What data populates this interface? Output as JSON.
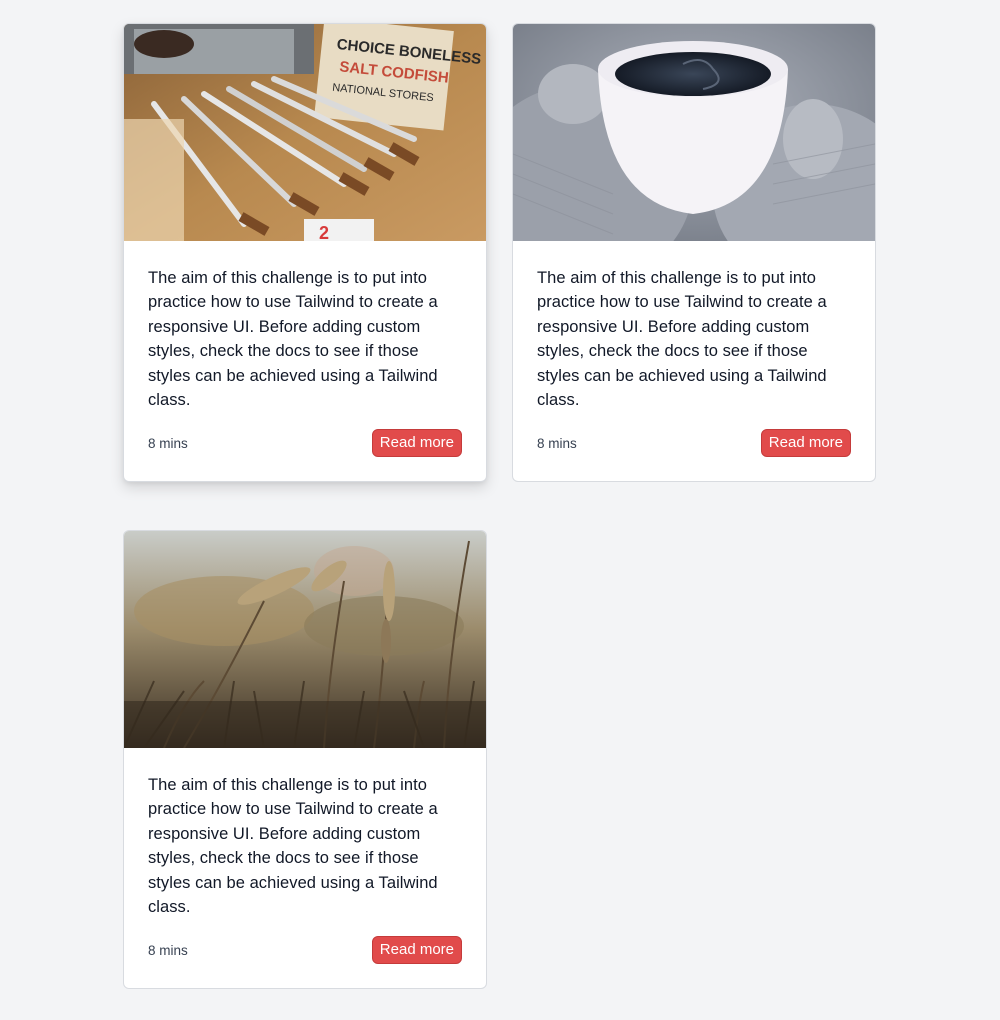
{
  "cards": [
    {
      "image": "sewing-tools-photo",
      "text": "The aim of this challenge is to put into practice how to use Tailwind to create a responsive UI. Before adding custom styles, check the docs to see if those styles can be achieved using a Tailwind class.",
      "time": "8 mins",
      "button_label": "Read more"
    },
    {
      "image": "coffee-mug-photo",
      "text": "The aim of this challenge is to put into practice how to use Tailwind to create a responsive UI. Before adding custom styles, check the docs to see if those styles can be achieved using a Tailwind class.",
      "time": "8 mins",
      "button_label": "Read more"
    },
    {
      "image": "wheat-field-photo",
      "text": "The aim of this challenge is to put into practice how to use Tailwind to create a responsive UI. Before adding custom styles, check the docs to see if those styles can be achieved using a Tailwind class.",
      "time": "8 mins",
      "button_label": "Read more"
    }
  ],
  "colors": {
    "page_background": "#f3f4f6",
    "card_background": "#ffffff",
    "button_background": "#e14b4b",
    "button_text": "#ffffff",
    "body_text": "#111827",
    "meta_text": "#374151"
  },
  "labels": {
    "watermark_box_words": [
      "CHOICE BONELESS",
      "SALT CODFISH",
      "NATIONAL STORES"
    ]
  }
}
